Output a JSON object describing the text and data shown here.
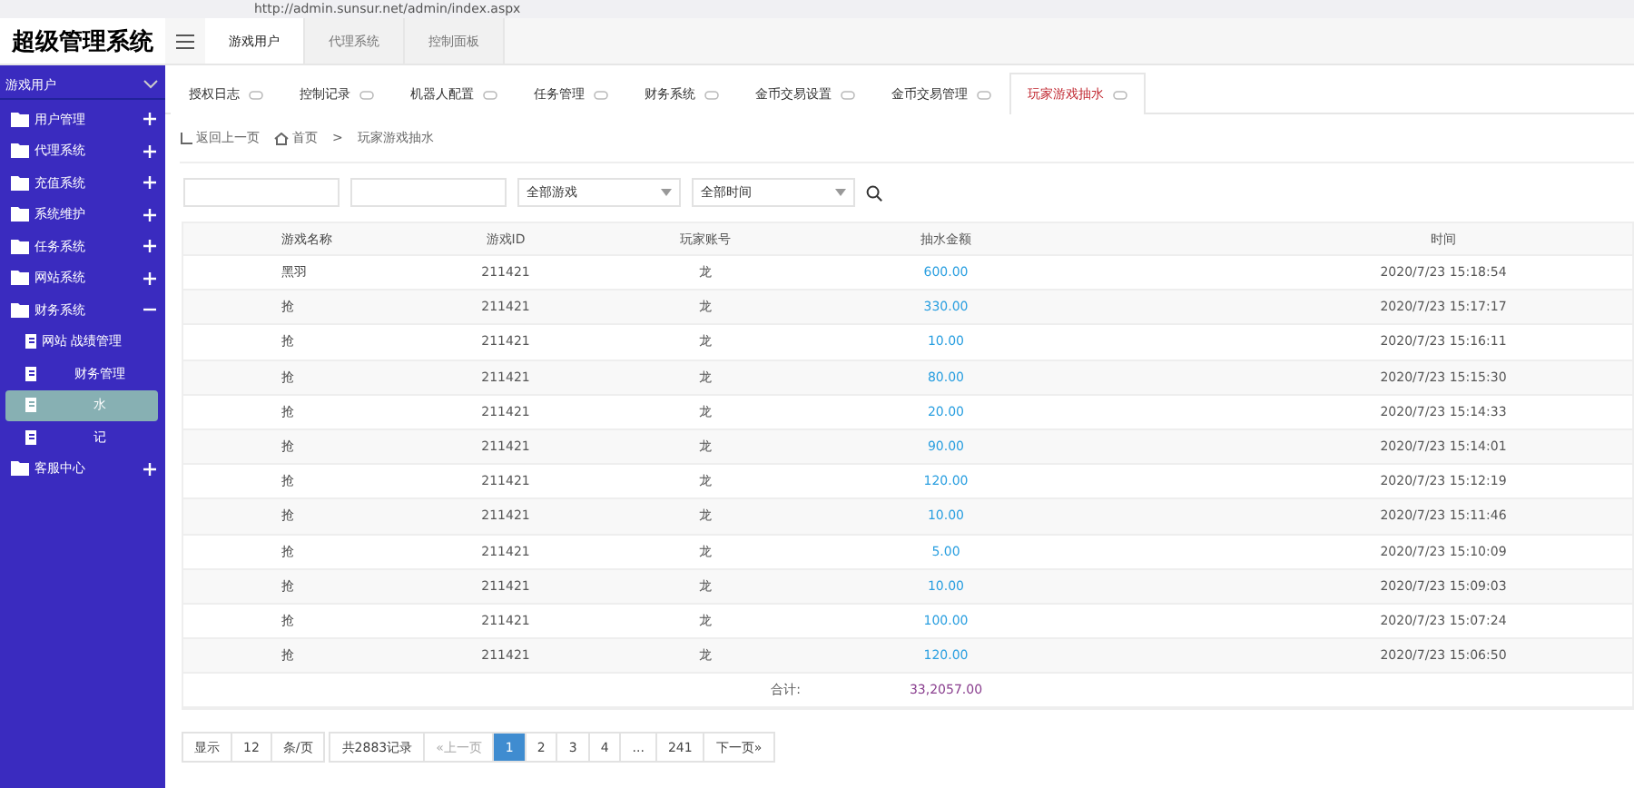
{
  "browser": {
    "url": "http://admin.sunsur.net/admin/index.aspx"
  },
  "logo": "超级管理系统",
  "top_tabs": [
    {
      "label": "游戏用户",
      "selected": true
    },
    {
      "label": "代理系统",
      "selected": false
    },
    {
      "label": "控制面板",
      "selected": false
    }
  ],
  "sidebar": {
    "title": "游戏用户",
    "items": [
      {
        "label": "用户管理",
        "expanded": false
      },
      {
        "label": "代理系统",
        "expanded": false
      },
      {
        "label": "充值系统",
        "expanded": false
      },
      {
        "label": "系统维护",
        "expanded": false
      },
      {
        "label": "任务系统",
        "expanded": false
      },
      {
        "label": "网站系统",
        "expanded": false
      },
      {
        "label": "财务系统",
        "expanded": true,
        "children": [
          {
            "label": "网站 战绩管理",
            "selected": false
          },
          {
            "label": "财务管理",
            "selected": false
          },
          {
            "label": "水",
            "selected": true
          },
          {
            "label": "记",
            "selected": false
          }
        ]
      },
      {
        "label": "客服中心",
        "expanded": false
      }
    ]
  },
  "page_tabs": [
    {
      "label": "授权日志",
      "selected": false
    },
    {
      "label": "控制记录",
      "selected": false
    },
    {
      "label": "机器人配置",
      "selected": false
    },
    {
      "label": "任务管理",
      "selected": false
    },
    {
      "label": "财务系统",
      "selected": false
    },
    {
      "label": "金币交易设置",
      "selected": false
    },
    {
      "label": "金币交易管理",
      "selected": false
    },
    {
      "label": "玩家游戏抽水",
      "selected": true
    }
  ],
  "breadcrumb": {
    "back": "返回上一页",
    "home": "首页",
    "separator": ">",
    "current": "玩家游戏抽水"
  },
  "filters": {
    "game": "全部游戏",
    "time": "全部时间"
  },
  "table": {
    "columns": [
      "游戏名称",
      "游戏ID",
      "玩家账号",
      "抽水金额",
      "时间"
    ],
    "rows": [
      [
        "黑羽",
        "211421",
        "龙",
        "600.00",
        "2020/7/23 15:18:54"
      ],
      [
        "抢",
        "211421",
        "龙",
        "330.00",
        "2020/7/23 15:17:17"
      ],
      [
        "抢",
        "211421",
        "龙",
        "10.00",
        "2020/7/23 15:16:11"
      ],
      [
        "抢",
        "211421",
        "龙",
        "80.00",
        "2020/7/23 15:15:30"
      ],
      [
        "抢",
        "211421",
        "龙",
        "20.00",
        "2020/7/23 15:14:33"
      ],
      [
        "抢",
        "211421",
        "龙",
        "90.00",
        "2020/7/23 15:14:01"
      ],
      [
        "抢",
        "211421",
        "龙",
        "120.00",
        "2020/7/23 15:12:19"
      ],
      [
        "抢",
        "211421",
        "龙",
        "10.00",
        "2020/7/23 15:11:46"
      ],
      [
        "抢",
        "211421",
        "龙",
        "5.00",
        "2020/7/23 15:10:09"
      ],
      [
        "抢",
        "211421",
        "龙",
        "10.00",
        "2020/7/23 15:09:03"
      ],
      [
        "抢",
        "211421",
        "龙",
        "100.00",
        "2020/7/23 15:07:24"
      ],
      [
        "抢",
        "211421",
        "龙",
        "120.00",
        "2020/7/23 15:06:50"
      ]
    ],
    "total_label": "合计:",
    "total_value": "33,2057.00"
  },
  "pagination": {
    "show": "显示",
    "per_page": "12",
    "unit": "条/页",
    "total": "共2883记录",
    "prev": "«上一页",
    "pages": [
      {
        "label": "1",
        "selected": true
      },
      {
        "label": "2",
        "selected": false
      },
      {
        "label": "3",
        "selected": false
      },
      {
        "label": "4",
        "selected": false
      },
      {
        "label": "...",
        "selected": false
      },
      {
        "label": "241",
        "selected": false
      }
    ],
    "next": "下一页»"
  }
}
